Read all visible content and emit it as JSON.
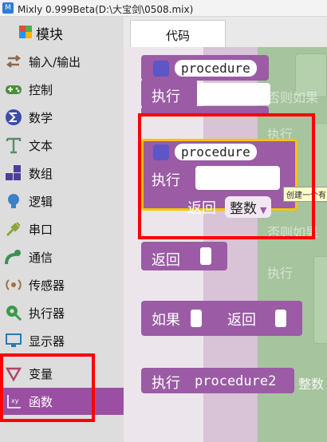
{
  "window": {
    "title": "Mixly 0.999Beta(D:\\大宝剑\\0508.mix)"
  },
  "sidebar": {
    "title": "模块",
    "items": [
      {
        "label": "输入/输出",
        "icon": "io-arrows-icon"
      },
      {
        "label": "控制",
        "icon": "gamepad-icon"
      },
      {
        "label": "数学",
        "icon": "math-icon"
      },
      {
        "label": "文本",
        "icon": "text-t-icon"
      },
      {
        "label": "数组",
        "icon": "array-blocks-icon"
      },
      {
        "label": "逻辑",
        "icon": "lightbulb-icon"
      },
      {
        "label": "串口",
        "icon": "serial-plug-icon"
      },
      {
        "label": "通信",
        "icon": "satellite-icon"
      },
      {
        "label": "传感器",
        "icon": "sensor-icon"
      },
      {
        "label": "执行器",
        "icon": "actuator-icon"
      },
      {
        "label": "显示器",
        "icon": "monitor-icon"
      },
      {
        "label": "变量",
        "icon": "variable-icon"
      },
      {
        "label": "函数",
        "icon": "function-icon",
        "selected": true
      }
    ]
  },
  "tabs": [
    {
      "label": "代码"
    }
  ],
  "blocks": {
    "procedure_no_return": {
      "name": "procedure",
      "do_label": "执行"
    },
    "procedure_with_return": {
      "name": "procedure",
      "do_label": "执行",
      "return_label": "返回",
      "return_type": "整数"
    },
    "return_block": {
      "label": "返回"
    },
    "if_return_block": {
      "if_label": "如果",
      "return_label": "返回"
    },
    "call_block": {
      "label": "执行",
      "name": "procedure2"
    }
  },
  "tooltip": {
    "text": "创建一个有"
  },
  "background_text": {
    "else_if_1": "否则如果",
    "do_1": "执行",
    "else_if_2": "否则如果",
    "do_2": "执行",
    "right_partial": "整数"
  },
  "colors": {
    "procedure_purple": "#9b5ba5",
    "selected_category": "#9b4fa3",
    "highlight_red": "#ff0000",
    "logic_green": "#a6c49e"
  }
}
